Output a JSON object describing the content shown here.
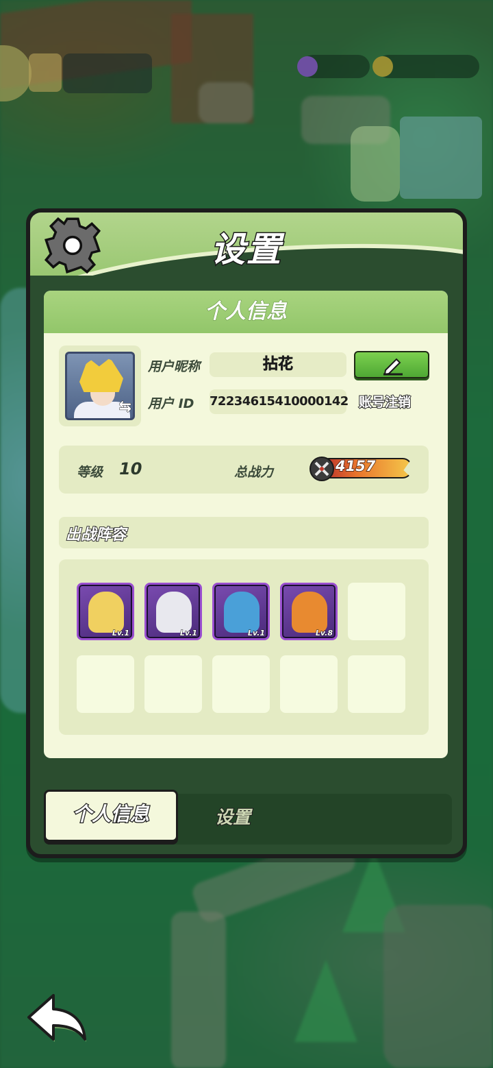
{
  "panel": {
    "title": "设置"
  },
  "profile": {
    "section_title": "个人信息",
    "nickname_label": "用户昵称",
    "nickname": "拈花",
    "id_label": "用户 ID",
    "user_id": "72234615410000142",
    "logout_label": "账号注销",
    "level_label": "等级",
    "level": "10",
    "power_label": "总战力",
    "power": "4157"
  },
  "lineup": {
    "title": "出战阵容",
    "heroes": [
      {
        "level": "Lv.1",
        "color": "#f0d060",
        "icon": "fairy-hero"
      },
      {
        "level": "Lv.1",
        "color": "#e8e8ee",
        "icon": "swordswoman-hero"
      },
      {
        "level": "Lv.1",
        "color": "#4aa0d8",
        "icon": "shark-hero"
      },
      {
        "level": "Lv.8",
        "color": "#e88a30",
        "icon": "mech-hero"
      }
    ],
    "empty_slots": 6
  },
  "tabs": {
    "active": "个人信息",
    "inactive": "设置"
  },
  "colors": {
    "header_green": "#9ac772",
    "card_bg": "#f4f8dc",
    "edit_button": "#4fa834",
    "hero_frame": "#9a4fd0"
  }
}
